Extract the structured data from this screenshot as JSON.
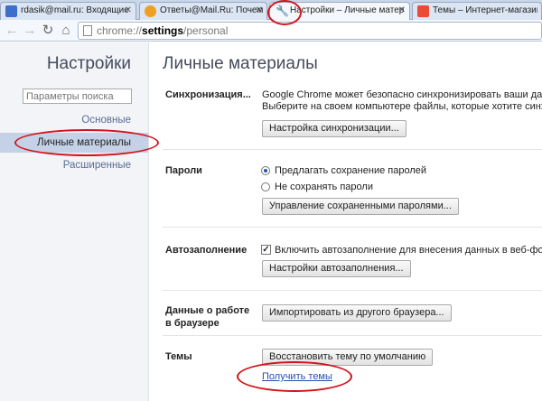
{
  "tabs": [
    {
      "title": "rdasik@mail.ru: Входящие",
      "active": false,
      "favicon_color": "#3d6ec9"
    },
    {
      "title": "Ответы@Mail.Ru: Почему у",
      "active": false,
      "favicon_color": "#f0a020"
    },
    {
      "title": "Настройки – Личные матер",
      "active": true,
      "favicon": "wrench-icon"
    },
    {
      "title": "Темы – Интернет-магазин С",
      "active": false,
      "favicon_color": "#e94b35"
    }
  ],
  "toolbar": {
    "url_scheme": "chrome://",
    "url_host": "settings",
    "url_path": "/personal"
  },
  "sidebar": {
    "title": "Настройки",
    "search_placeholder": "Параметры поиска",
    "items": [
      {
        "label": "Основные",
        "selected": false
      },
      {
        "label": "Личные материалы",
        "selected": true
      },
      {
        "label": "Расширенные",
        "selected": false
      }
    ]
  },
  "main": {
    "title": "Личные материалы",
    "sync": {
      "label": "Синхронизация...",
      "desc1": "Google Chrome может безопасно синхронизировать ваши данные с",
      "desc2": "Выберите на своем компьютере файлы, которые хотите синхрониз",
      "button": "Настройка синхронизации..."
    },
    "passwords": {
      "label": "Пароли",
      "option1": "Предлагать сохранение паролей",
      "option2": "Не сохранять пароли",
      "option1_selected": true,
      "button": "Управление сохраненными паролями..."
    },
    "autofill": {
      "label": "Автозаполнение",
      "checkbox_label": "Включить автозаполнение для внесения данных в веб-формы од",
      "checked": true,
      "button": "Настройки автозаполнения..."
    },
    "browser_data": {
      "label_line1": "Данные о работе",
      "label_line2": "в браузере",
      "button": "Импортировать из другого браузера..."
    },
    "themes": {
      "label": "Темы",
      "button": "Восстановить тему по умолчанию",
      "link": "Получить темы"
    }
  },
  "colors": {
    "annotation": "#d2141c",
    "link": "#2a4db0",
    "selected_nav": "#c4d1e6"
  }
}
